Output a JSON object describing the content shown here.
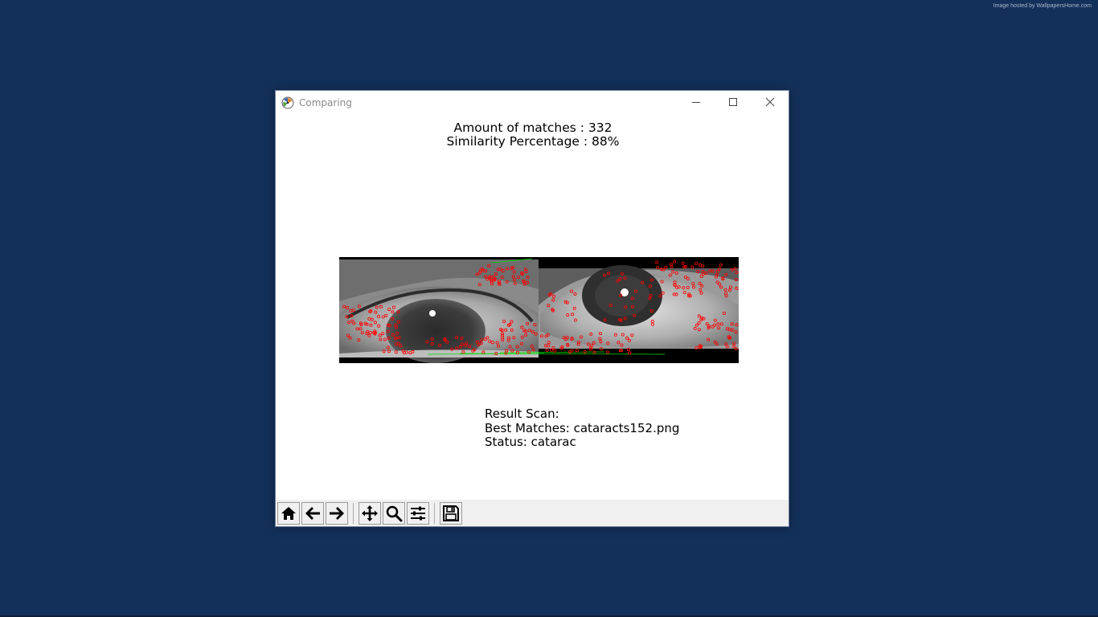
{
  "desktop": {
    "watermark": "Image hosted by WallpapersHome.com",
    "background_color": "#13305b"
  },
  "window": {
    "title": "Comparing",
    "controls": {
      "minimize_icon": "minimize-icon",
      "maximize_icon": "maximize-icon",
      "close_icon": "close-icon"
    }
  },
  "figure": {
    "matches_line": "Amount of matches : 332",
    "similarity_line": "Similarity Percentage : 88%",
    "images": {
      "left": "query eye image with keypoints",
      "right": "matched eye image with keypoints",
      "keypoint_color": "#ff0000",
      "match_line_color": "#00dd00"
    },
    "result": {
      "heading": "Result Scan:",
      "best_matches": "Best Matches: cataracts152.png",
      "status": "Status: catarac"
    }
  },
  "toolbar": {
    "buttons": [
      {
        "name": "home-icon"
      },
      {
        "name": "back-arrow-icon"
      },
      {
        "name": "forward-arrow-icon"
      },
      {
        "name": "pan-icon"
      },
      {
        "name": "zoom-icon"
      },
      {
        "name": "configure-subplots-icon"
      },
      {
        "name": "save-icon"
      }
    ]
  }
}
